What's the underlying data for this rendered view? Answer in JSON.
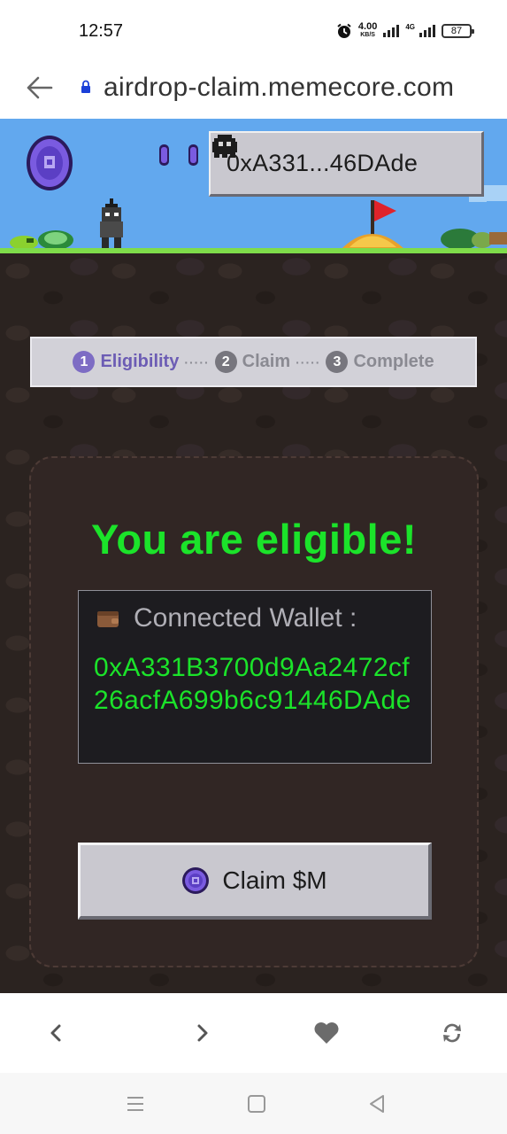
{
  "status_bar": {
    "time": "12:57",
    "net_speed_value": "4.00",
    "net_speed_unit": "KB/S",
    "network_type": "4G",
    "battery": "87"
  },
  "browser": {
    "url": "airdrop-claim.memecore.com"
  },
  "header": {
    "wallet_button_label": "0xA331...46DAde"
  },
  "steps": [
    {
      "number": "1",
      "label": "Eligibility",
      "active": true
    },
    {
      "number": "2",
      "label": "Claim",
      "active": false
    },
    {
      "number": "3",
      "label": "Complete",
      "active": false
    }
  ],
  "steps_separator": "·····",
  "card": {
    "headline": "You are eligible!",
    "wallet_label": "Connected Wallet :",
    "wallet_address": "0xA331B3700d9Aa2472cf26acfA699b6c91446DAde",
    "claim_button_label": "Claim $M"
  },
  "colors": {
    "accent_green": "#1be32a",
    "active_step": "#6c5cb4",
    "sky": "#62a8ee",
    "coin_purple": "#6f4fd8"
  },
  "icons": [
    "back-arrow-icon",
    "lock-icon",
    "alarm-icon",
    "coin-icon",
    "ghost-avatar-icon",
    "wallet-icon",
    "chevron-left-icon",
    "chevron-right-icon",
    "heart-icon",
    "refresh-icon",
    "menu-icon",
    "home-square-icon",
    "back-triangle-icon"
  ]
}
